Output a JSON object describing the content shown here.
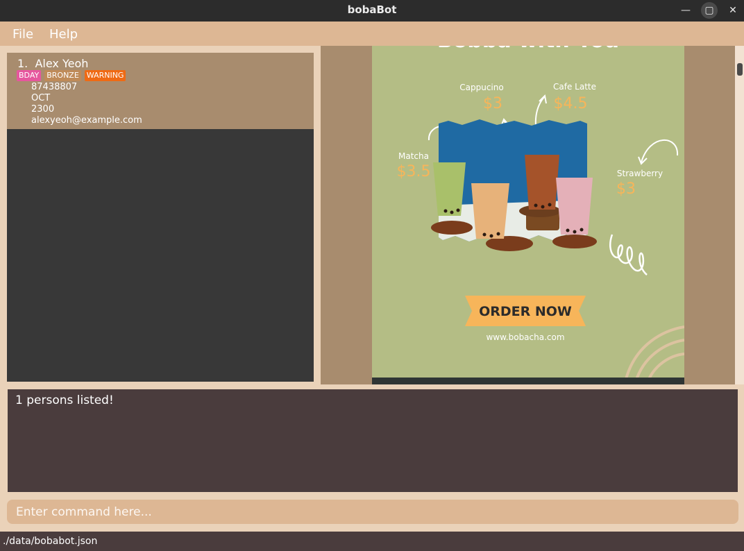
{
  "window": {
    "title": "bobaBot",
    "minimize_icon": "minimize-icon",
    "maximize_icon": "maximize-icon",
    "close_icon": "close-icon"
  },
  "menu": {
    "file": "File",
    "help": "Help"
  },
  "persons": [
    {
      "index": "1.",
      "name": "Alex Yeoh",
      "tags": [
        "BDAY",
        "BRONZE",
        "WARNING"
      ],
      "phone": "87438807",
      "birthday_month": "OCT",
      "reward_points": "2300",
      "email": "alexyeoh@example.com"
    }
  ],
  "poster": {
    "heading": "Bobba with You",
    "drinks": [
      {
        "name": "Cappucino",
        "price": "$3"
      },
      {
        "name": "Cafe Latte",
        "price": "$4.5"
      },
      {
        "name": "Matcha",
        "price": "$3.5"
      },
      {
        "name": "Strawberry",
        "price": "$3"
      }
    ],
    "cta": "ORDER NOW",
    "website": "www.bobacha.com",
    "colors": {
      "background": "#b4bd85",
      "price": "#f7b55a",
      "ribbon": "#f7b55a"
    }
  },
  "result": {
    "message": "1 persons listed!"
  },
  "command": {
    "placeholder": "Enter command here..."
  },
  "status": {
    "path": "./data/bobabot.json"
  },
  "colors": {
    "menubar": "#ddb794",
    "card": "#a88c6e",
    "result_bg": "#4a3c3d",
    "list_bg": "#383838"
  }
}
